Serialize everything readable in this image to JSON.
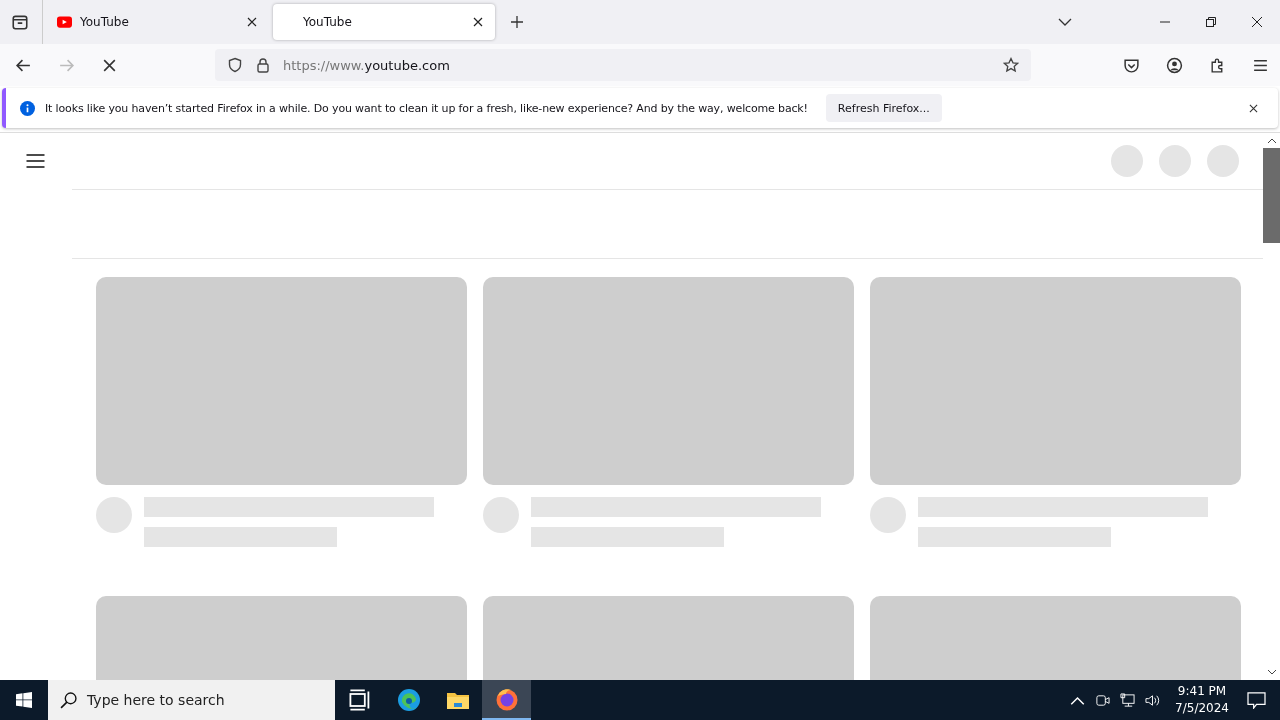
{
  "tabs": [
    {
      "title": "YouTube",
      "selected": false,
      "favicon": true
    },
    {
      "title": "YouTube",
      "selected": true,
      "favicon": false
    }
  ],
  "address_bar": {
    "url_prefix": "https://www.",
    "url_domain": "youtube.com"
  },
  "notification": {
    "message": "It looks like you haven’t started Firefox in a while. Do you want to clean it up for a fresh, like-new experience? And by the way, welcome back!",
    "button": "Refresh Firefox..."
  },
  "taskbar": {
    "search_placeholder": "Type here to search",
    "apps": [
      {
        "kind": "taskview",
        "selected": false
      },
      {
        "kind": "edge",
        "selected": false
      },
      {
        "kind": "explorer",
        "selected": false
      },
      {
        "kind": "firefox",
        "selected": true
      }
    ],
    "time": "9:41 PM",
    "date": "7/5/2024"
  }
}
